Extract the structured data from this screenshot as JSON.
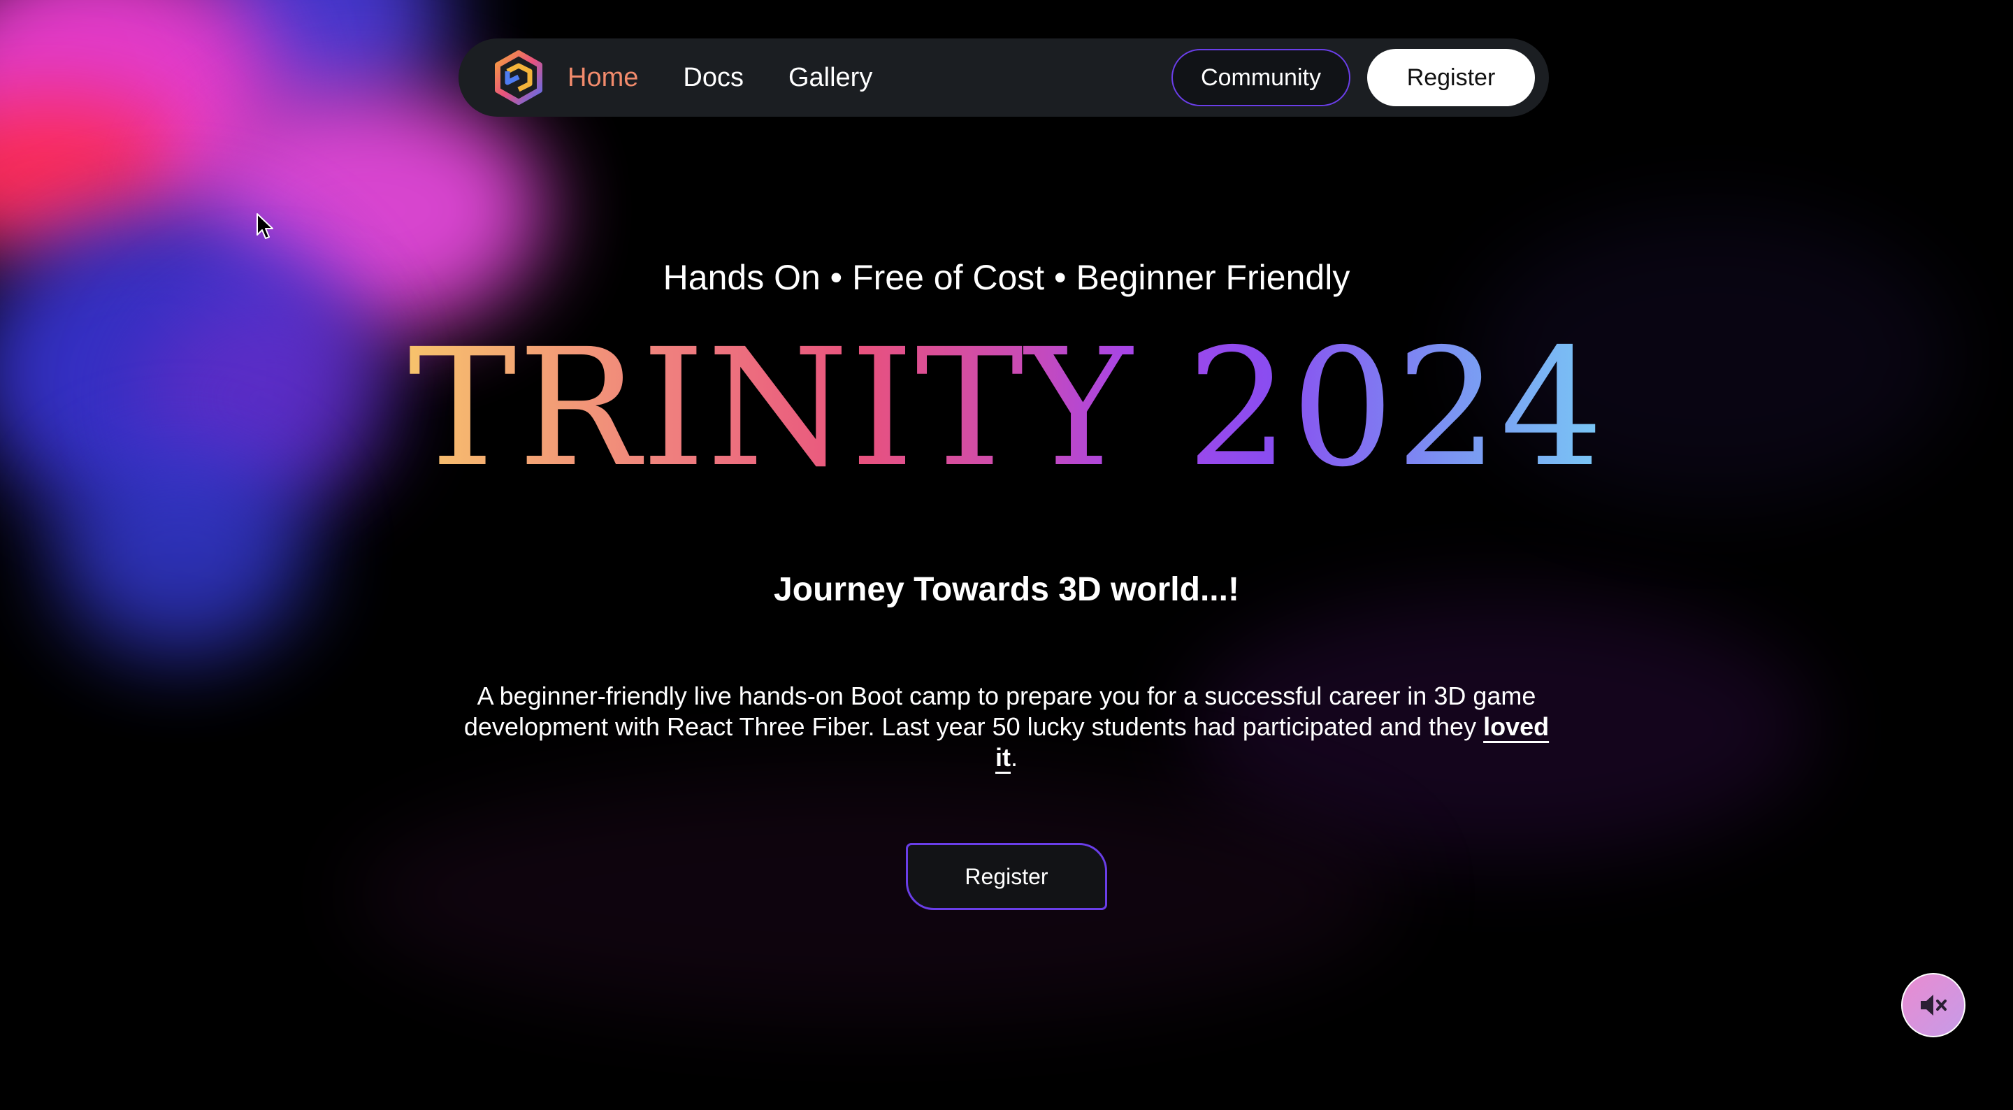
{
  "nav": {
    "logo_icon": "trinity-cube-logo-icon",
    "links": [
      {
        "label": "Home",
        "active": true
      },
      {
        "label": "Docs",
        "active": false
      },
      {
        "label": "Gallery",
        "active": false
      }
    ],
    "community_label": "Community",
    "register_label": "Register"
  },
  "hero": {
    "tagline": "Hands On • Free of Cost • Beginner Friendly",
    "title": "TRINITY 2024",
    "subtitle": "Journey Towards 3D world...!",
    "description_before": "A beginner-friendly live hands-on Boot camp to prepare you for a successful career in 3D game development with React Three Fiber. Last year 50 lucky students had participated and they ",
    "description_link": "loved it",
    "description_after": ".",
    "register_label": "Register"
  },
  "audio": {
    "icon": "speaker-muted-icon",
    "muted": true
  },
  "colors": {
    "background": "#000000",
    "nav_bg": "#1b1e22",
    "active_link": "#f28b6c",
    "accent_border": "#6a3ee8",
    "gradient": [
      "#f7c36c",
      "#e8527e",
      "#a745e6",
      "#79c8f5"
    ]
  }
}
